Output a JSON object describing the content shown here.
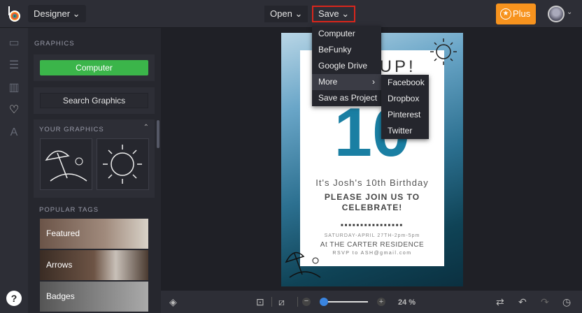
{
  "topbar": {
    "mode": "Designer",
    "open": "Open",
    "save": "Save",
    "plus": "Plus"
  },
  "save_menu": {
    "items": [
      "Computer",
      "BeFunky",
      "Google Drive",
      "More",
      "Save as Project"
    ],
    "more_submenu": [
      "Facebook",
      "Dropbox",
      "Pinterest",
      "Twitter"
    ]
  },
  "panel": {
    "title": "GRAPHICS",
    "computer_button": "Computer",
    "search_button": "Search Graphics",
    "your_graphics": "YOUR GRAPHICS",
    "popular_tags": "POPULAR TAGS",
    "tags": [
      "Featured",
      "Arrows",
      "Badges"
    ]
  },
  "poster": {
    "headline": "S UP!",
    "number": "10",
    "line1": "It's Josh's 10th Birthday",
    "line2": "PLEASE JOIN US TO",
    "line3": "CELEBRATE!",
    "dashes": "■■■■■■■■■■■■■■■■",
    "date": "SATURDAY-APRIL 27TH-2pm-5pm",
    "place": "At THE CARTER RESIDENCE",
    "rsvp": "RSVP to ASH@gmail.com"
  },
  "bottombar": {
    "zoom": "24 %",
    "zoom_fraction": 0.0
  },
  "colors": {
    "accent": "#3bb54a",
    "plus": "#f7931e",
    "save_border": "#d9261c",
    "poster_number": "#1a7fa3"
  }
}
